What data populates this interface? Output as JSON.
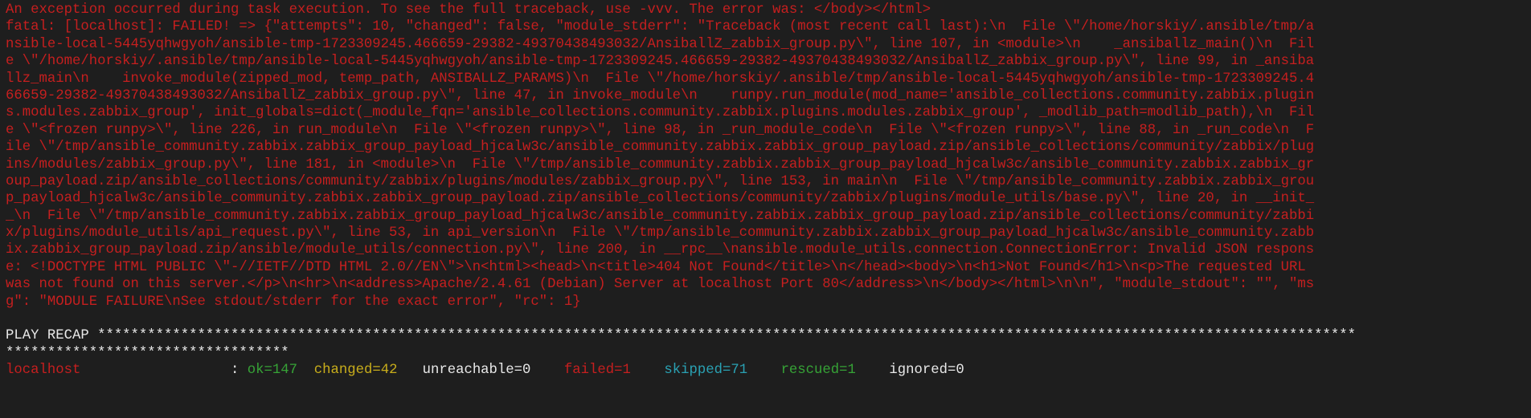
{
  "terminal": {
    "exception_line": "An exception occurred during task execution. To see the full traceback, use -vvv. The error was: </body></html>",
    "fatal_lines": [
      "fatal: [localhost]: FAILED! => {\"attempts\": 10, \"changed\": false, \"module_stderr\": \"Traceback (most recent call last):\\n  File \\\"/home/horskiy/.ansible/tmp/a",
      "nsible-local-5445yqhwgyoh/ansible-tmp-1723309245.466659-29382-49370438493032/AnsiballZ_zabbix_group.py\\\", line 107, in <module>\\n    _ansiballz_main()\\n  Fil",
      "e \\\"/home/horskiy/.ansible/tmp/ansible-local-5445yqhwgyoh/ansible-tmp-1723309245.466659-29382-49370438493032/AnsiballZ_zabbix_group.py\\\", line 99, in _ansiba",
      "llz_main\\n    invoke_module(zipped_mod, temp_path, ANSIBALLZ_PARAMS)\\n  File \\\"/home/horskiy/.ansible/tmp/ansible-local-5445yqhwgyoh/ansible-tmp-1723309245.4",
      "66659-29382-49370438493032/AnsiballZ_zabbix_group.py\\\", line 47, in invoke_module\\n    runpy.run_module(mod_name='ansible_collections.community.zabbix.plugin",
      "s.modules.zabbix_group', init_globals=dict(_module_fqn='ansible_collections.community.zabbix.plugins.modules.zabbix_group', _modlib_path=modlib_path),\\n  Fil",
      "e \\\"<frozen runpy>\\\", line 226, in run_module\\n  File \\\"<frozen runpy>\\\", line 98, in _run_module_code\\n  File \\\"<frozen runpy>\\\", line 88, in _run_code\\n  F",
      "ile \\\"/tmp/ansible_community.zabbix.zabbix_group_payload_hjcalw3c/ansible_community.zabbix.zabbix_group_payload.zip/ansible_collections/community/zabbix/plug",
      "ins/modules/zabbix_group.py\\\", line 181, in <module>\\n  File \\\"/tmp/ansible_community.zabbix.zabbix_group_payload_hjcalw3c/ansible_community.zabbix.zabbix_gr",
      "oup_payload.zip/ansible_collections/community/zabbix/plugins/modules/zabbix_group.py\\\", line 153, in main\\n  File \\\"/tmp/ansible_community.zabbix.zabbix_grou",
      "p_payload_hjcalw3c/ansible_community.zabbix.zabbix_group_payload.zip/ansible_collections/community/zabbix/plugins/module_utils/base.py\\\", line 20, in __init_",
      "_\\n  File \\\"/tmp/ansible_community.zabbix.zabbix_group_payload_hjcalw3c/ansible_community.zabbix.zabbix_group_payload.zip/ansible_collections/community/zabbi",
      "x/plugins/module_utils/api_request.py\\\", line 53, in api_version\\n  File \\\"/tmp/ansible_community.zabbix.zabbix_group_payload_hjcalw3c/ansible_community.zabb",
      "ix.zabbix_group_payload.zip/ansible/module_utils/connection.py\\\", line 200, in __rpc__\\nansible.module_utils.connection.ConnectionError: Invalid JSON respons",
      "e: <!DOCTYPE HTML PUBLIC \\\"-//IETF//DTD HTML 2.0//EN\\\">\\n<html><head>\\n<title>404 Not Found</title>\\n</head><body>\\n<h1>Not Found</h1>\\n<p>The requested URL",
      "was not found on this server.</p>\\n<hr>\\n<address>Apache/2.4.61 (Debian) Server at localhost Port 80</address>\\n</body></html>\\n\\n\", \"module_stdout\": \"\", \"ms",
      "g\": \"MODULE FAILURE\\nSee stdout/stderr for the exact error\", \"rc\": 1}"
    ],
    "recap_header_1": "PLAY RECAP *******************************************************************************************************************************************************",
    "recap_header_2": "**********************************",
    "recap": {
      "host": "localhost",
      "host_pad": "                  ",
      "colon": ": ",
      "ok": "ok=147",
      "changed": "changed=42",
      "unreachable": "unreachable=0",
      "failed": "failed=1",
      "skipped": "skipped=71",
      "rescued": "rescued=1",
      "ignored": "ignored=0"
    },
    "colors": {
      "background": "#1e1e1e",
      "error_red": "#c61f1f",
      "ok_green": "#36a336",
      "changed_yellow": "#c8ad1b",
      "skipped_cyan": "#2aa1b3",
      "text_white": "#e8e8e8"
    }
  }
}
